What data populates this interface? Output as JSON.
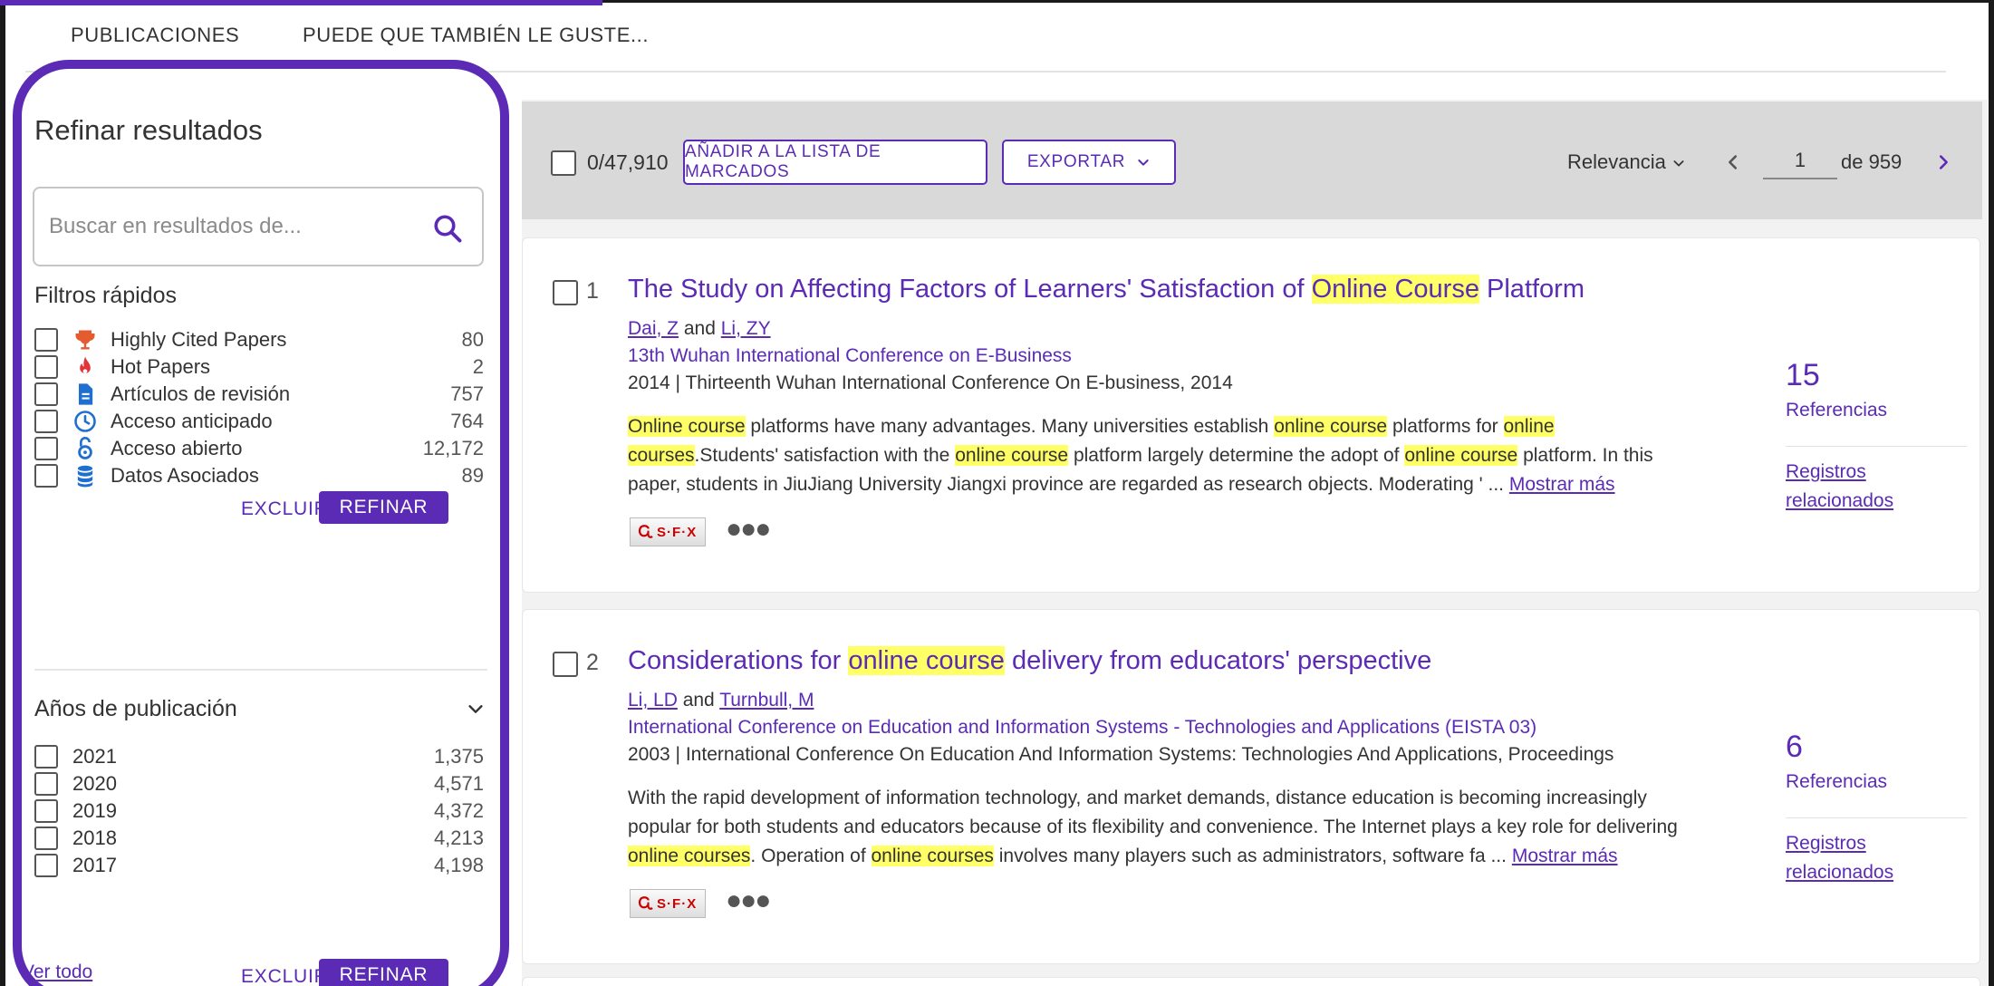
{
  "tabs": [
    {
      "label": "PUBLICACIONES",
      "active": true
    },
    {
      "label": "PUEDE QUE TAMBIÉN LE GUSTE..."
    }
  ],
  "sidebar": {
    "title": "Refinar resultados",
    "search_placeholder": "Buscar en resultados de...",
    "quick_filters_title": "Filtros rápidos",
    "quick_filters": [
      {
        "label": "Highly Cited Papers",
        "count": "80",
        "icon": "trophy-icon"
      },
      {
        "label": "Hot Papers",
        "count": "2",
        "icon": "flame-icon"
      },
      {
        "label": "Artículos de revisión",
        "count": "757",
        "icon": "document-icon"
      },
      {
        "label": "Acceso anticipado",
        "count": "764",
        "icon": "clock-icon"
      },
      {
        "label": "Acceso abierto",
        "count": "12,172",
        "icon": "open-lock-icon"
      },
      {
        "label": "Datos Asociados",
        "count": "89",
        "icon": "database-icon"
      }
    ],
    "excluir_label": "EXCLUIR",
    "refinar_label": "REFINAR",
    "years_title": "Años de publicación",
    "years": [
      {
        "label": "2021",
        "count": "1,375"
      },
      {
        "label": "2020",
        "count": "4,571"
      },
      {
        "label": "2019",
        "count": "4,372"
      },
      {
        "label": "2018",
        "count": "4,213"
      },
      {
        "label": "2017",
        "count": "4,198"
      }
    ],
    "ver_todo": "Ver todo"
  },
  "toolbar": {
    "selected_count": "0/47,910",
    "add_marked_label": "AÑADIR A LA LISTA DE MARCADOS",
    "export_label": "EXPORTAR",
    "sort_label": "Relevancia",
    "page_value": "1",
    "page_of": "de 959"
  },
  "results": [
    {
      "number": "1",
      "title_pre": "The Study on Affecting Factors of Learners' Satisfaction of ",
      "title_hl": "Online Course",
      "title_post": " Platform",
      "author1": "Dai, Z",
      "author_and": " and ",
      "author2": "Li, ZY",
      "conference": "13th Wuhan International Conference on E-Business",
      "year": "2014",
      "source": " | Thirteenth Wuhan International Conference On E-business, 2014",
      "abstract": {
        "l1": {
          "h1": "Online course",
          "t1": " platforms have many advantages. Many universities establish ",
          "h2": "online course",
          "t2": " platforms for ",
          "h3": "online"
        },
        "l2": {
          "h1": "courses",
          "t1": ".Students' satisfaction with the ",
          "h2": "online course",
          "t2": " platform largely determine the adopt of ",
          "h3": "online course",
          "t3": " platform. In this"
        },
        "l3": {
          "t1": "paper, students in JiuJiang University Jiangxi province are regarded as research objects. Moderating ' ... "
        }
      },
      "show_more": "Mostrar más",
      "sfx_label": "S·F·X",
      "ref_count": "15",
      "ref_label": "Referencias",
      "related_l1": "Registros",
      "related_l2": "relacionados"
    },
    {
      "number": "2",
      "title_pre": "Considerations for ",
      "title_hl": "online course",
      "title_post": " delivery from educators' perspective",
      "author1": "Li, LD",
      "author_and": " and ",
      "author2": "Turnbull, M",
      "conference": "International Conference on Education and Information Systems - Technologies and Applications (EISTA 03)",
      "year": "2003",
      "source": " | International Conference On Education And Information Systems: Technologies And Applications, Proceedings",
      "abstract": {
        "l1": {
          "t1": "With the rapid development of information technology, and market demands, distance education is becoming increasingly"
        },
        "l2": {
          "t1": "popular for both students and educators because of its flexibility and convenience. The Internet plays a key role for delivering"
        },
        "l3": {
          "h1": "online courses",
          "t1": ". Operation of ",
          "h2": "online courses",
          "t2": " involves many players such as administrators, software fa ... "
        }
      },
      "show_more": "Mostrar más",
      "sfx_label": "S·F·X",
      "ref_count": "6",
      "ref_label": "Referencias",
      "related_l1": "Registros",
      "related_l2": "relacionados"
    }
  ],
  "colors": {
    "accent": "#5b2bb5",
    "highlight": "#ffff66",
    "toolbar_bg": "#d9d9d9"
  }
}
